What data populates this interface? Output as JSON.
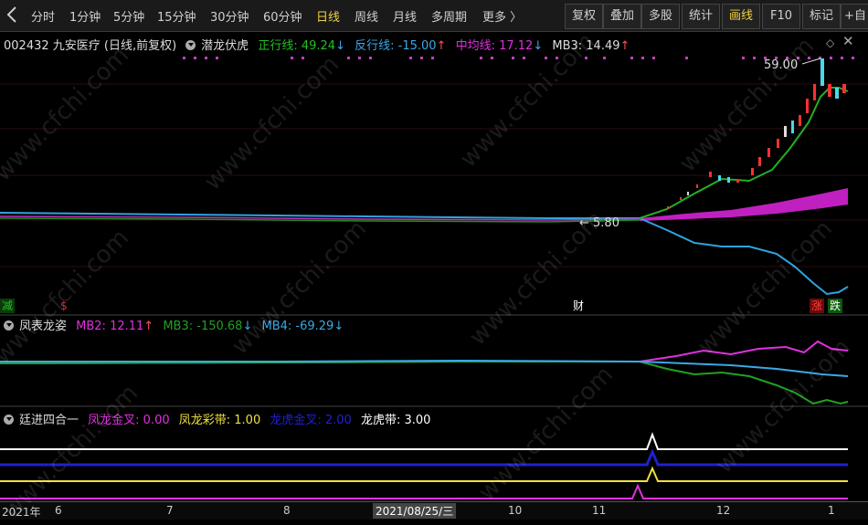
{
  "toolbar": {
    "back_icon": "back-arrow-icon",
    "periods": [
      "分时",
      "1分钟",
      "5分钟",
      "15分钟",
      "30分钟",
      "60分钟",
      "日线",
      "周线",
      "月线",
      "多周期",
      "更多 〉"
    ],
    "active_period": "日线",
    "right_buttons": [
      "复权",
      "叠加",
      "多股",
      "统计",
      "画线",
      "F10",
      "标记",
      "+自"
    ],
    "highlighted_button": "画线"
  },
  "main_pane": {
    "stock": "002432 九安医疗 (日线,前复权)",
    "indicator": "潜龙伏虎",
    "labels": [
      {
        "text": "正行线: 49.24",
        "arrow": "↓",
        "color": "#22c022"
      },
      {
        "text": "反行线: -15.00",
        "arrow": "↑",
        "color": "#3aa8e8"
      },
      {
        "text": "中均线: 17.12",
        "arrow": "↓",
        "color": "#e030e0"
      },
      {
        "text": "MB3: 14.49",
        "arrow": "↑",
        "color": "#dddddd"
      }
    ],
    "high_label": "59.00",
    "low_label": "← 5.80",
    "markers": [
      {
        "text": "减",
        "color": "#22c022"
      },
      {
        "text": "$",
        "color": "#e03030"
      },
      {
        "text": "财",
        "color": "#ffffff"
      },
      {
        "text": "涨",
        "color": "#ff4040"
      },
      {
        "text": "跌",
        "color": "#22c022"
      }
    ]
  },
  "pane2": {
    "indicator": "凤表龙姿",
    "labels": [
      {
        "text": "MB2: 12.11",
        "arrow": "↑",
        "color": "#e030e0"
      },
      {
        "text": "MB3: -150.68",
        "arrow": "↓",
        "color": "#22a022"
      },
      {
        "text": "MB4: -69.29",
        "arrow": "↓",
        "color": "#3aa8e8"
      }
    ]
  },
  "pane3": {
    "indicator": "廷进四合一",
    "labels": [
      {
        "text": "凤龙金叉: 0.00",
        "color": "#e030e0"
      },
      {
        "text": "凤龙彩带: 1.00",
        "color": "#f0e040"
      },
      {
        "text": "龙虎金叉: 2.00",
        "color": "#2020d0"
      },
      {
        "text": "龙虎带: 3.00",
        "color": "#ffffff"
      }
    ]
  },
  "x_axis": {
    "labels": [
      "2021年",
      "6",
      "7",
      "8",
      "2021/08/25/三",
      "10",
      "11",
      "12",
      "1"
    ]
  },
  "watermark": "www.cfchi.com"
}
